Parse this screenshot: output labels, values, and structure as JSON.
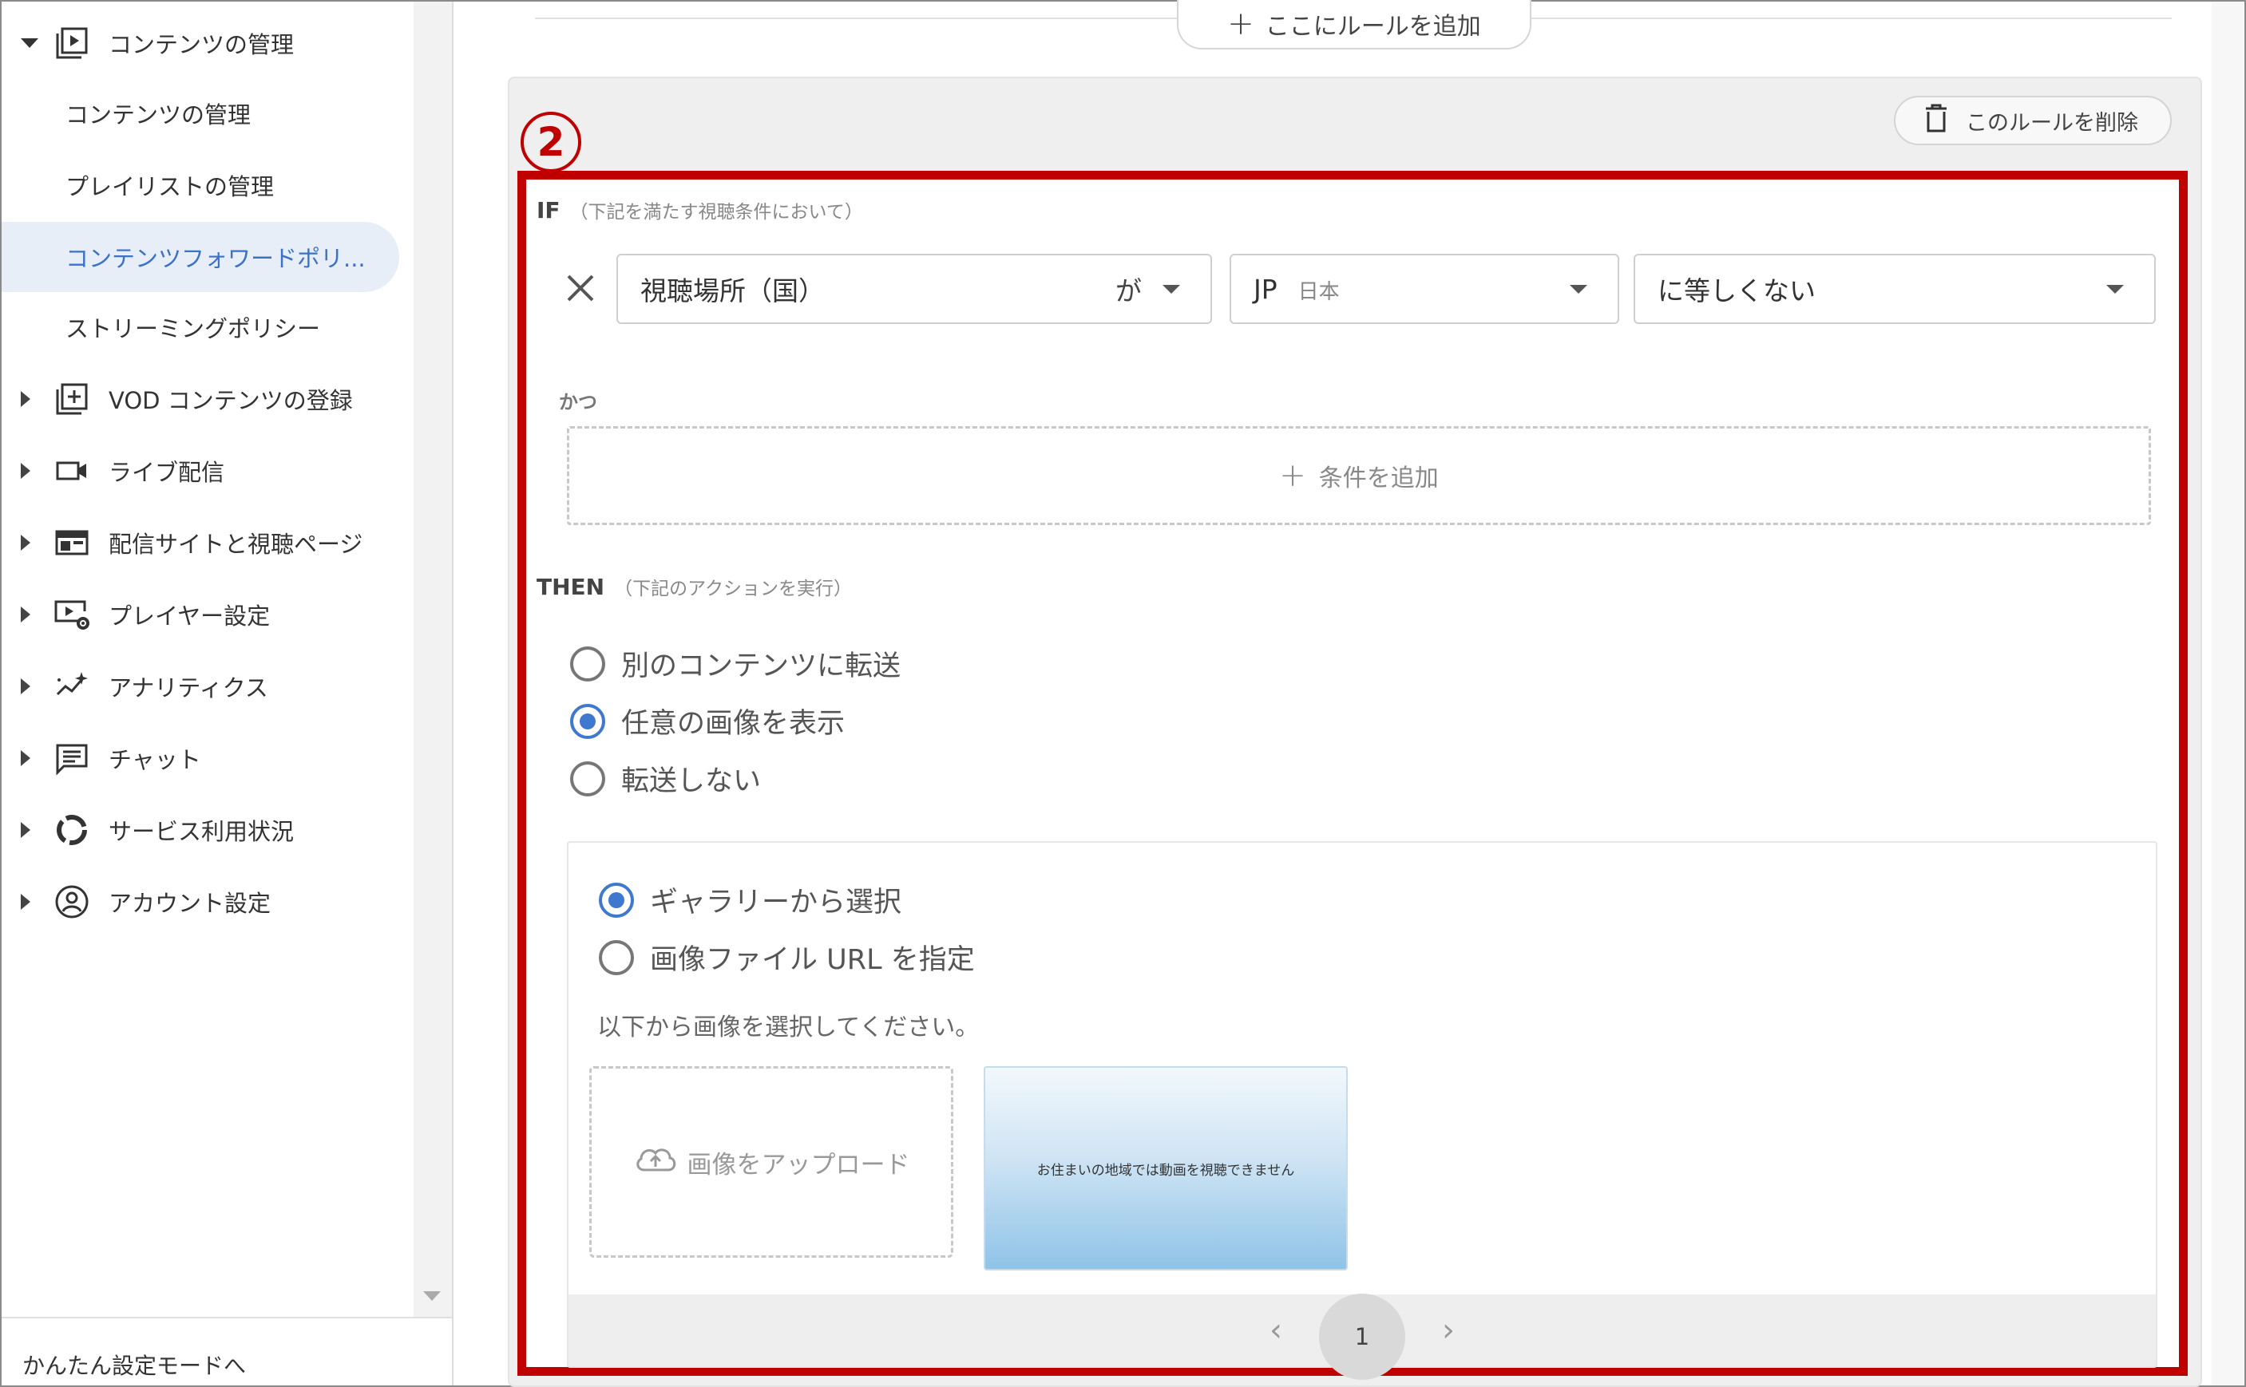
{
  "sidebar": {
    "sections": [
      {
        "label": "コンテンツの管理",
        "icon": "content-play-icon",
        "expanded": true
      },
      {
        "label": "VOD コンテンツの登録",
        "icon": "add-box-icon"
      },
      {
        "label": "ライブ配信",
        "icon": "video-camera-icon"
      },
      {
        "label": "配信サイトと視聴ページ",
        "icon": "web-layout-icon"
      },
      {
        "label": "プレイヤー設定",
        "icon": "player-settings-icon"
      },
      {
        "label": "アナリティクス",
        "icon": "analytics-icon"
      },
      {
        "label": "チャット",
        "icon": "chat-icon"
      },
      {
        "label": "サービス利用状況",
        "icon": "usage-donut-icon"
      },
      {
        "label": "アカウント設定",
        "icon": "account-icon"
      }
    ],
    "subitems": [
      {
        "label": "コンテンツの管理"
      },
      {
        "label": "プレイリストの管理"
      },
      {
        "label": "コンテンツフォワードポリ...",
        "active": true
      },
      {
        "label": "ストリーミングポリシー"
      }
    ],
    "footer_link": "かんたん設定モードへ"
  },
  "toolbar": {
    "add_rule_here": "ここにルールを追加",
    "delete_rule": "このルールを削除"
  },
  "annotation": {
    "number": "2",
    "color": "#c00000"
  },
  "rule": {
    "if_label": "IF",
    "if_hint": "（下記を満たす視聴条件において）",
    "condition": {
      "field": "視聴場所（国）",
      "particle": "が",
      "country_code": "JP",
      "country_name": "日本",
      "operator": "に等しくない"
    },
    "and_label": "かつ",
    "add_condition": "条件を追加",
    "then_label": "THEN",
    "then_hint": "（下記のアクションを実行）",
    "actions": [
      {
        "label": "別のコンテンツに転送",
        "selected": false
      },
      {
        "label": "任意の画像を表示",
        "selected": true
      },
      {
        "label": "転送しない",
        "selected": false
      }
    ],
    "image_source": [
      {
        "label": "ギャラリーから選択",
        "selected": true
      },
      {
        "label": "画像ファイル URL を指定",
        "selected": false
      }
    ],
    "instruction": "以下から画像を選択してください。",
    "upload_label": "画像をアップロード",
    "thumbnail_text": "お住まいの地域では動画を視聴できません",
    "pagination": {
      "prev": "‹",
      "current": "1",
      "next": "›"
    }
  },
  "colors": {
    "accent": "#3f78cf",
    "highlight": "#c00000",
    "active_bg": "#e8eef8"
  }
}
